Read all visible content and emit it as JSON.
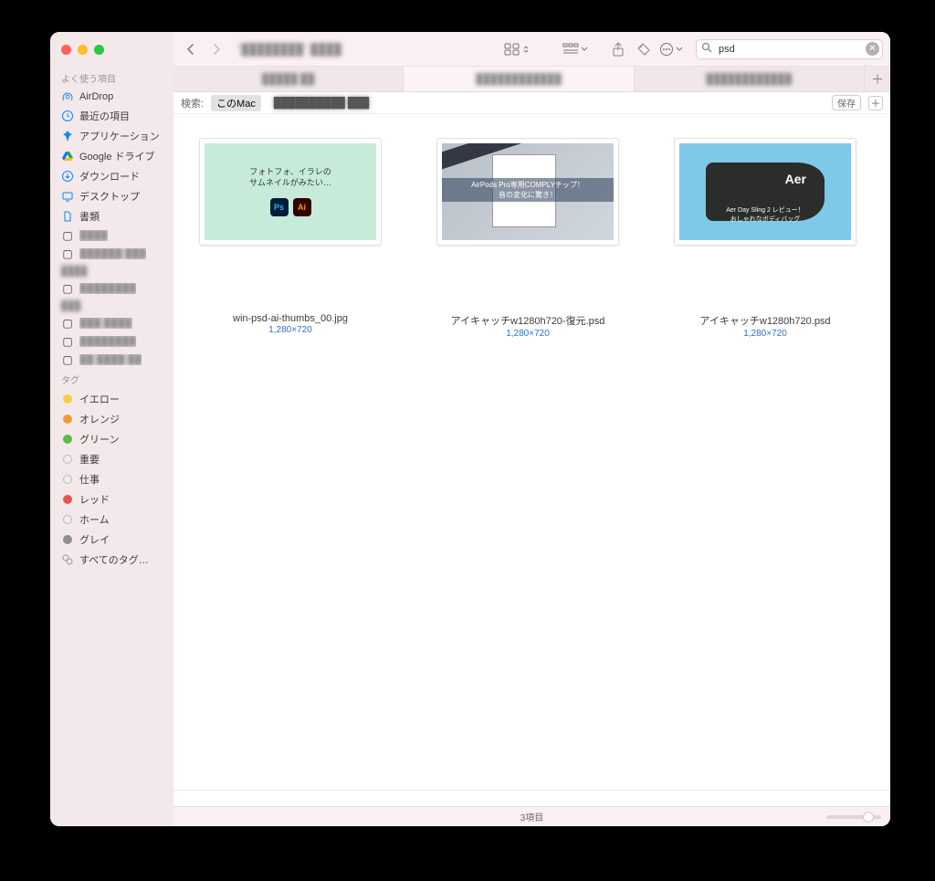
{
  "sidebar": {
    "favorites_header": "よく使う項目",
    "items": [
      {
        "icon": "airdrop",
        "label": "AirDrop",
        "color": "#0a84ff"
      },
      {
        "icon": "clock",
        "label": "最近の項目",
        "color": "#0a84ff"
      },
      {
        "icon": "apps",
        "label": "アプリケーション",
        "color": "#0a84ff"
      },
      {
        "icon": "gdrive",
        "label": "Google ドライブ",
        "color": "#1a73e8"
      },
      {
        "icon": "download",
        "label": "ダウンロード",
        "color": "#0a84ff"
      },
      {
        "icon": "desktop",
        "label": "デスクトップ",
        "color": "#0a84ff"
      },
      {
        "icon": "doc",
        "label": "書類",
        "color": "#0a84ff"
      }
    ],
    "tags_header": "タグ",
    "tags": [
      {
        "label": "イエロー",
        "color": "#f7ce46"
      },
      {
        "label": "オレンジ",
        "color": "#f19a37"
      },
      {
        "label": "グリーン",
        "color": "#61ba46"
      },
      {
        "label": "重要",
        "color": ""
      },
      {
        "label": "仕事",
        "color": ""
      },
      {
        "label": "レッド",
        "color": "#e8554d"
      },
      {
        "label": "ホーム",
        "color": ""
      },
      {
        "label": "グレイ",
        "color": "#8e8e93"
      },
      {
        "label": "すべてのタグ…",
        "color": "all"
      }
    ]
  },
  "toolbar": {
    "title_redacted": "\"████████\" ████"
  },
  "search": {
    "value": "psd"
  },
  "tabs": [
    {
      "label": "█████ ██",
      "active": false
    },
    {
      "label": "████████████",
      "active": true
    },
    {
      "label": "████████████",
      "active": false
    }
  ],
  "scope": {
    "label": "検索:",
    "options": [
      "このMac"
    ],
    "redacted": "██████████  ███",
    "save": "保存"
  },
  "files": [
    {
      "name": "win-psd-ai-thumbs_00.jpg",
      "dimensions": "1,280×720",
      "thumb": {
        "kind": "t1",
        "line1": "フォトフォ、イラレの",
        "line2": "サムネイルがみたい…",
        "ps": "Ps",
        "ai": "Ai"
      }
    },
    {
      "name": "アイキャッチw1280h720-復元.psd",
      "dimensions": "1,280×720",
      "thumb": {
        "kind": "t2",
        "band1": "AirPods Pro専用COMPLYチップ！",
        "band2": "音の変化に驚き！"
      }
    },
    {
      "name": "アイキャッチw1280h720.psd",
      "dimensions": "1,280×720",
      "thumb": {
        "kind": "t3",
        "brand": "Aer",
        "cap1": "Aer Day Sling 2 レビュー！",
        "cap2": "おしゃれなボディバッグ"
      }
    }
  ],
  "status": {
    "count": "3項目"
  }
}
